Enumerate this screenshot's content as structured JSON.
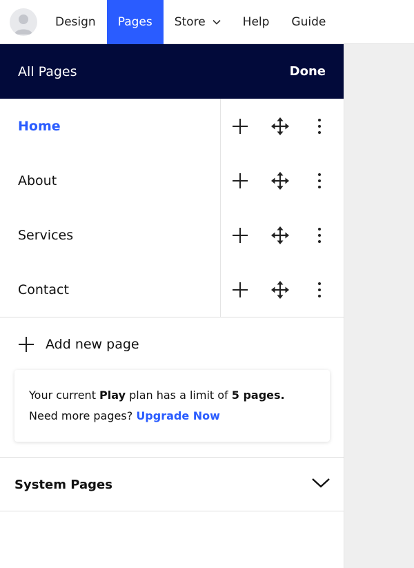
{
  "topnav": {
    "items": [
      {
        "label": "Design"
      },
      {
        "label": "Pages"
      },
      {
        "label": "Store"
      },
      {
        "label": "Help"
      },
      {
        "label": "Guide"
      }
    ],
    "active": "Pages"
  },
  "panel": {
    "title": "All Pages",
    "done_label": "Done",
    "pages": [
      {
        "label": "Home",
        "current": true
      },
      {
        "label": "About"
      },
      {
        "label": "Services"
      },
      {
        "label": "Contact"
      }
    ],
    "add_page_label": "Add new page",
    "plan": {
      "line1_prefix": "Your current ",
      "plan_name": "Play",
      "line1_middle": " plan has a limit of ",
      "limit": "5 pages.",
      "line2_prefix": "Need more pages? ",
      "upgrade_label": "Upgrade Now"
    },
    "system_pages_label": "System Pages"
  },
  "colors": {
    "accent": "#2a5cff",
    "header_bg": "#020a3a",
    "canvas_bg": "#efefef"
  }
}
